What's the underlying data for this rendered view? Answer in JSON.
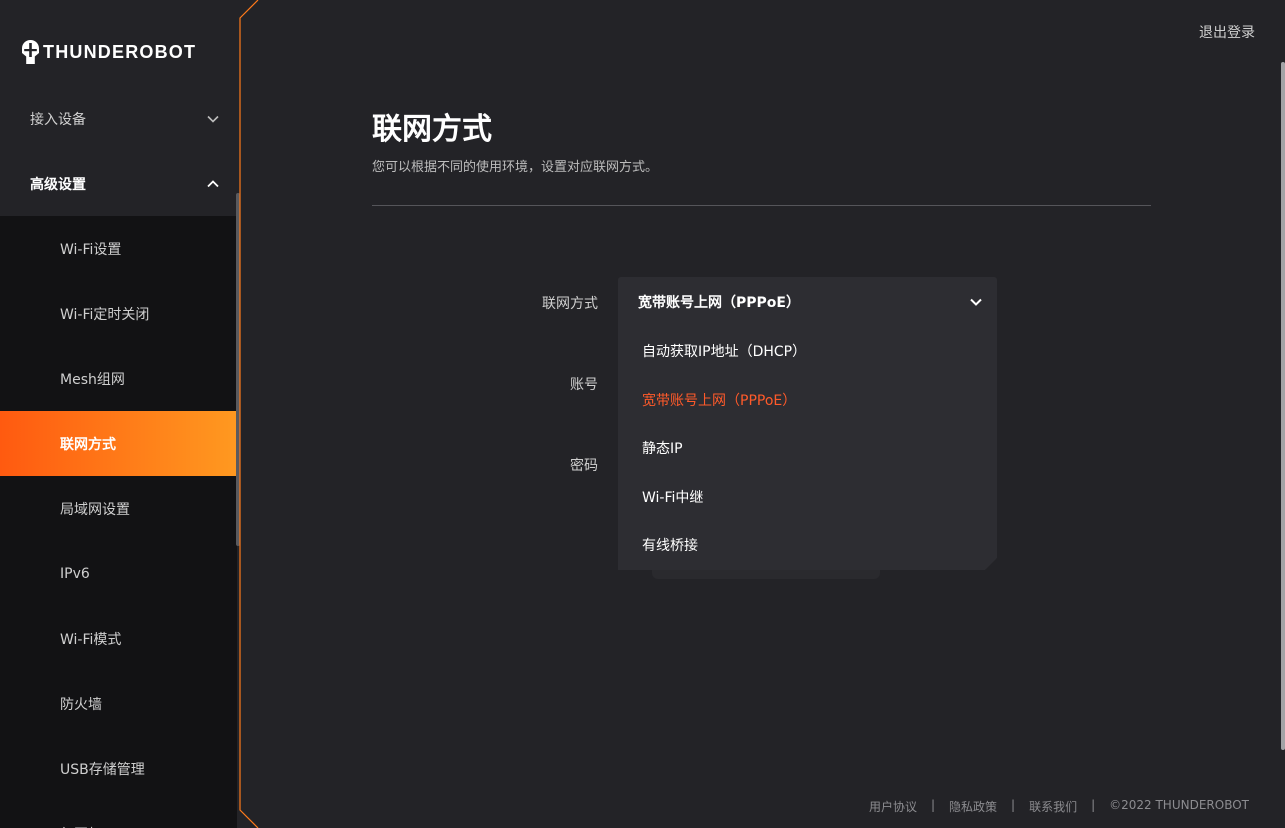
{
  "brand": {
    "name": "THUNDEROBOT"
  },
  "header": {
    "logout_label": "退出登录"
  },
  "sidebar": {
    "groups": [
      {
        "label": "接入设备",
        "expanded": false
      },
      {
        "label": "高级设置",
        "expanded": true
      }
    ],
    "submenu": [
      {
        "label": "Wi-Fi设置",
        "active": false
      },
      {
        "label": "Wi-Fi定时关闭",
        "active": false
      },
      {
        "label": "Mesh组网",
        "active": false
      },
      {
        "label": "联网方式",
        "active": true
      },
      {
        "label": "局域网设置",
        "active": false
      },
      {
        "label": "IPv6",
        "active": false
      },
      {
        "label": "Wi-Fi模式",
        "active": false
      },
      {
        "label": "防火墙",
        "active": false
      },
      {
        "label": "USB存储管理",
        "active": false
      },
      {
        "label": "氛围灯",
        "active": false
      }
    ]
  },
  "main": {
    "title": "联网方式",
    "description": "您可以根据不同的使用环境，设置对应联网方式。",
    "form": {
      "connection_label": "联网方式",
      "account_label": "账号",
      "password_label": "密码",
      "selected_value": "宽带账号上网（PPPoE）",
      "options": [
        "自动获取IP地址（DHCP）",
        "宽带账号上网（PPPoE）",
        "静态IP",
        "Wi-Fi中继",
        "有线桥接"
      ],
      "selected_index": 1
    }
  },
  "footer": {
    "links": [
      "用户协议",
      "隐私政策",
      "联系我们"
    ],
    "separator": "|",
    "copyright": "©2022 THUNDEROBOT"
  },
  "colors": {
    "accent_start": "#ff5a10",
    "accent_end": "#ff9920",
    "selected_option": "#ff5a2a",
    "background": "#232327",
    "sidebar_sub_bg": "#121214"
  }
}
